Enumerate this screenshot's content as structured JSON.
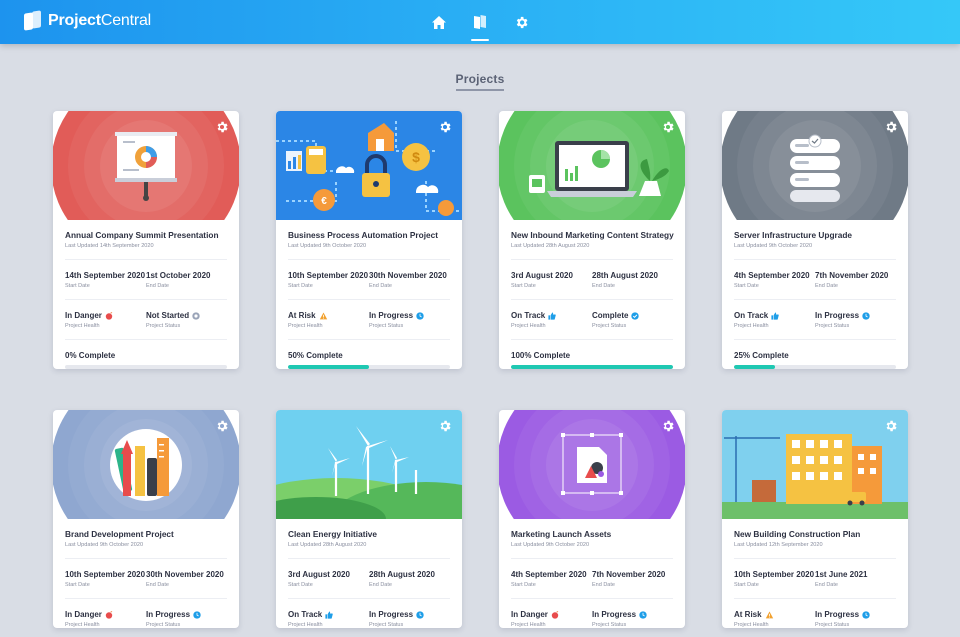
{
  "app": {
    "logo_bold": "Project",
    "logo_rest": "Central"
  },
  "nav": [
    {
      "icon": "home-icon",
      "active": false
    },
    {
      "icon": "projects-icon",
      "active": true
    },
    {
      "icon": "settings-icon",
      "active": false
    }
  ],
  "section_title": "Projects",
  "labels": {
    "start_date": "Start Date",
    "end_date": "End Date",
    "project_health": "Project Health",
    "project_status": "Project Status",
    "complete_suffix": "Complete"
  },
  "colors": {
    "progress": "#1fc8b2",
    "danger": "#e84c4c",
    "risk": "#f2a230",
    "on_track": "#1e9ee8",
    "in_progress": "#1e9ee8",
    "complete": "#1e9ee8",
    "not_started": "#9aa4b8"
  },
  "projects": [
    {
      "title": "Annual Company Summit Presentation",
      "updated": "Last Updated 14th September 2020",
      "start": "14th September 2020",
      "end": "1st October 2020",
      "health": "In Danger",
      "health_icon": "danger-icon",
      "status": "Not Started",
      "status_icon": "not-started-icon",
      "progress_label": "0% Complete",
      "progress": 0,
      "hero": "presentation",
      "hero_color": "#e15c58"
    },
    {
      "title": "Business Process Automation Project",
      "updated": "Last Updated 9th October 2020",
      "start": "10th September 2020",
      "end": "30th November 2020",
      "health": "At Risk",
      "health_icon": "warning-icon",
      "status": "In Progress",
      "status_icon": "in-progress-icon",
      "progress_label": "50% Complete",
      "progress": 50,
      "hero": "automation",
      "hero_color": "#2b86e6"
    },
    {
      "title": "New Inbound Marketing Content Strategy",
      "updated": "Last Updated 28th August 2020",
      "start": "3rd August 2020",
      "end": "28th August 2020",
      "health": "On Track",
      "health_icon": "thumbs-up-icon",
      "status": "Complete",
      "status_icon": "check-icon",
      "progress_label": "100% Complete",
      "progress": 100,
      "hero": "laptop",
      "hero_color": "#5bc35e"
    },
    {
      "title": "Server Infrastructure Upgrade",
      "updated": "Last Updated 9th October 2020",
      "start": "4th September 2020",
      "end": "7th November 2020",
      "health": "On Track",
      "health_icon": "thumbs-up-icon",
      "status": "In Progress",
      "status_icon": "in-progress-icon",
      "progress_label": "25% Complete",
      "progress": 25,
      "hero": "server",
      "hero_color": "#6f7a86"
    },
    {
      "title": "Brand Development Project",
      "updated": "Last Updated 9th October 2020",
      "start": "10th September 2020",
      "end": "30th November 2020",
      "health": "In Danger",
      "health_icon": "danger-icon",
      "status": "In Progress",
      "status_icon": "in-progress-icon",
      "progress_label": "",
      "progress": null,
      "hero": "brand",
      "hero_color": "#8fa7d0"
    },
    {
      "title": "Clean Energy Initiative",
      "updated": "Last Updated 28th August 2020",
      "start": "3rd August 2020",
      "end": "28th August 2020",
      "health": "On Track",
      "health_icon": "thumbs-up-icon",
      "status": "In Progress",
      "status_icon": "in-progress-icon",
      "progress_label": "",
      "progress": null,
      "hero": "energy",
      "hero_color": "#6fd0f0"
    },
    {
      "title": "Marketing Launch Assets",
      "updated": "Last Updated 9th October 2020",
      "start": "4th September 2020",
      "end": "7th November 2020",
      "health": "In Danger",
      "health_icon": "danger-icon",
      "status": "In Progress",
      "status_icon": "in-progress-icon",
      "progress_label": "",
      "progress": null,
      "hero": "design",
      "hero_color": "#9b5be3"
    },
    {
      "title": "New Building Construction Plan",
      "updated": "Last Updated 12th September 2020",
      "start": "10th September 2020",
      "end": "1st June 2021",
      "health": "At Risk",
      "health_icon": "warning-icon",
      "status": "In Progress",
      "status_icon": "in-progress-icon",
      "progress_label": "",
      "progress": null,
      "hero": "building",
      "hero_color": "#7fd0ee"
    }
  ]
}
